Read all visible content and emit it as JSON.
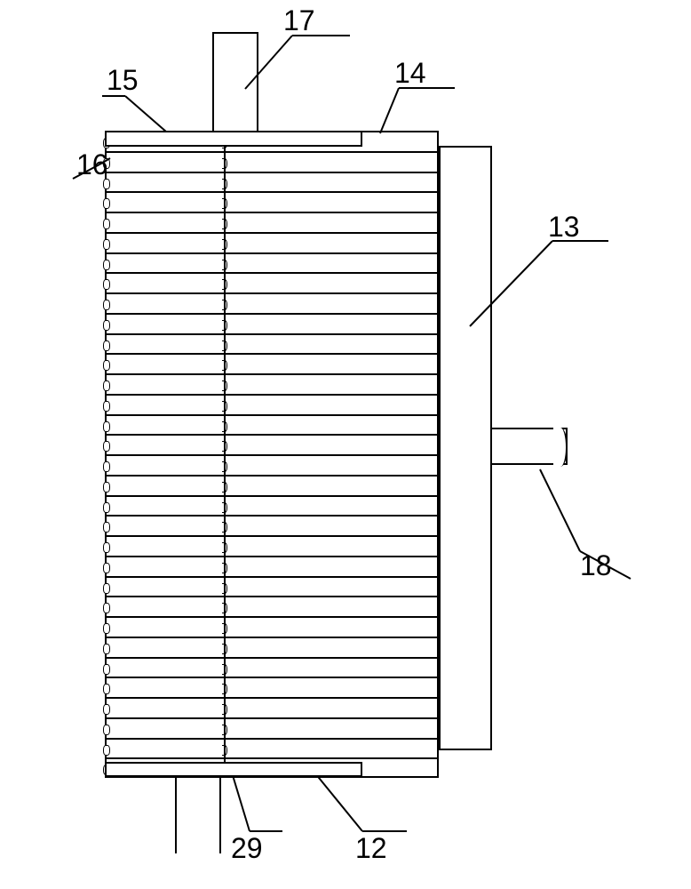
{
  "diagram": {
    "labels": {
      "l12": "12",
      "l13": "13",
      "l14": "14",
      "l15": "15",
      "l16": "16",
      "l17": "17",
      "l18": "18",
      "l29": "29"
    },
    "parts": {
      "12": "bottom mounting block",
      "13": "support column",
      "14": "fin end",
      "15": "top mounting block",
      "16": "fin edge connector",
      "17": "upper post",
      "18": "shaft",
      "29": "center joint"
    },
    "chart_data": null
  }
}
